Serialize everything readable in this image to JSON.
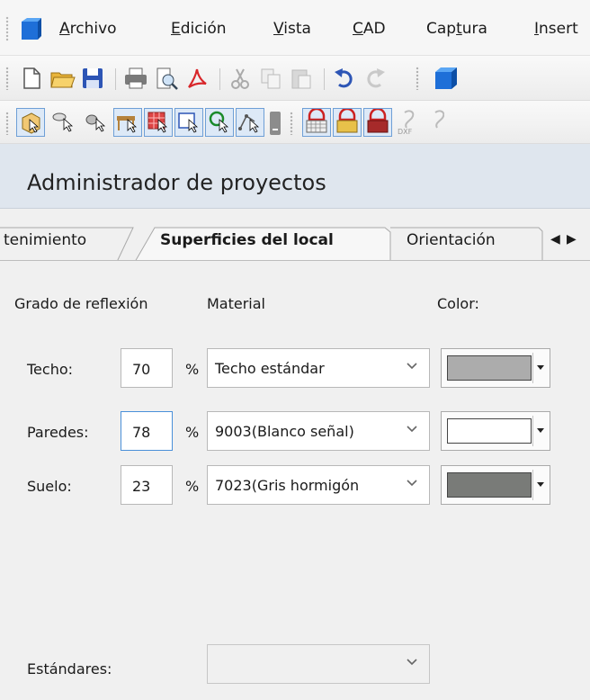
{
  "menu": {
    "items": [
      "Archivo",
      "Edición",
      "Vista",
      "CAD",
      "Captura",
      "Insert"
    ],
    "underline_index": [
      0,
      0,
      0,
      0,
      3,
      0
    ]
  },
  "toolbar1": {
    "icons": [
      "new-file-icon",
      "open-folder-icon",
      "save-icon",
      "print-icon",
      "print-preview-icon",
      "pdf-icon",
      "cut-icon",
      "copy-icon",
      "paste-icon",
      "undo-icon",
      "redo-icon",
      "cube-icon"
    ]
  },
  "toolbar2": {
    "icons": [
      "select-room-icon",
      "select-luminaire-icon",
      "select-object-icon",
      "select-furniture-icon",
      "select-calc-surface-icon",
      "select-area-icon",
      "select-point-icon",
      "select-polygon-icon",
      "material-grid-icon",
      "material-red-icon",
      "material-texture-icon",
      "dxf-icon"
    ],
    "dxf_label": "DXF"
  },
  "panel": {
    "title": "Administrador de proyectos"
  },
  "tabs": {
    "items": [
      "tenimiento",
      "Superficies del local",
      "Orientación"
    ],
    "active": "Superficies del local"
  },
  "surfaces": {
    "headers": {
      "reflection": "Grado de reflexión",
      "material": "Material",
      "color": "Color:"
    },
    "percent_sign": "%",
    "rows": [
      {
        "label": "Techo:",
        "value": "70",
        "material": "Techo estándar",
        "color": "#acacac"
      },
      {
        "label": "Paredes:",
        "value": "78",
        "material": "9003(Blanco señal)",
        "color": "#ffffff"
      },
      {
        "label": "Suelo:",
        "value": "23",
        "material": "7023(Gris hormigón",
        "color": "#797b78"
      }
    ],
    "standards_label": "Estándares:",
    "standards_value": ""
  },
  "colors": {
    "header_bg": "#dfe6ee",
    "focus": "#4a90d9",
    "toolbar_active": "#dde9f7"
  }
}
